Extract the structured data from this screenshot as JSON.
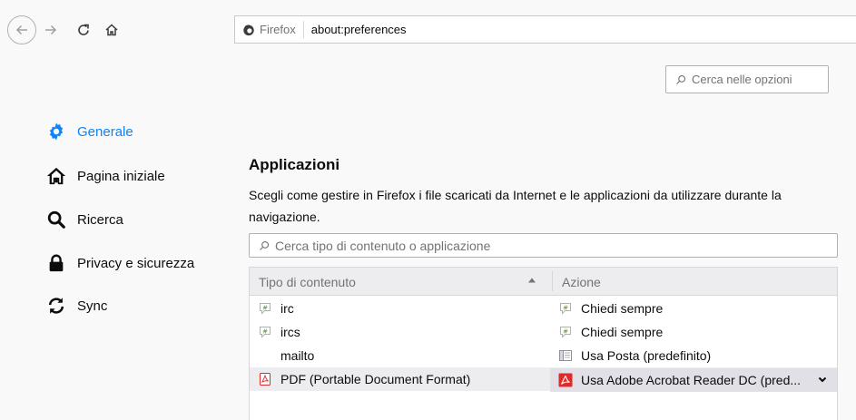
{
  "toolbar": {
    "identity_label": "Firefox",
    "url": "about:preferences"
  },
  "search_options": {
    "placeholder": "Cerca nelle opzioni"
  },
  "sidebar": {
    "items": [
      {
        "label": "Generale",
        "icon": "gear-icon",
        "selected": true
      },
      {
        "label": "Pagina iniziale",
        "icon": "home-icon"
      },
      {
        "label": "Ricerca",
        "icon": "search-icon"
      },
      {
        "label": "Privacy e sicurezza",
        "icon": "lock-icon"
      },
      {
        "label": "Sync",
        "icon": "sync-icon"
      }
    ]
  },
  "applications": {
    "title": "Applicazioni",
    "description": "Scegli come gestire in Firefox i file scaricati da Internet e le applicazioni da utilizzare durante la navigazione.",
    "search_placeholder": "Cerca tipo di contenuto o applicazione",
    "columns": {
      "type": "Tipo di contenuto",
      "action": "Azione"
    },
    "rows": [
      {
        "type": "irc",
        "type_icon": "chat-icon",
        "action": "Chiedi sempre",
        "action_icon": "chat-icon"
      },
      {
        "type": "ircs",
        "type_icon": "chat-icon",
        "action": "Chiedi sempre",
        "action_icon": "chat-icon"
      },
      {
        "type": "mailto",
        "type_icon": "",
        "action": "Usa Posta (predefinito)",
        "action_icon": "mail-app-icon"
      },
      {
        "type": "PDF (Portable Document Format)",
        "type_icon": "pdf-icon",
        "action": "Usa Adobe Acrobat Reader DC  (pred...",
        "action_icon": "acrobat-icon",
        "selected": true
      }
    ]
  },
  "colors": {
    "accent": "#0a84ff",
    "pdf_red": "#e02a2a"
  }
}
